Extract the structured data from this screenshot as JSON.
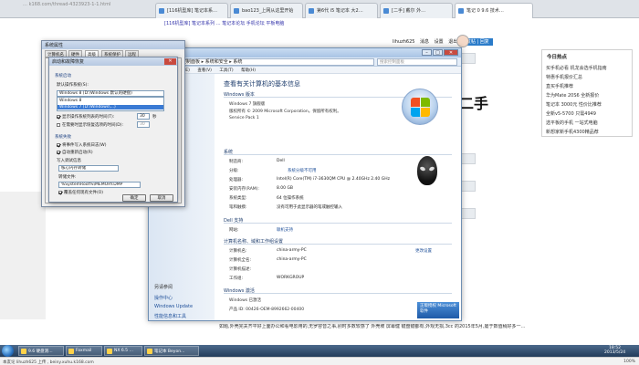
{
  "browser": {
    "url": "… k168.com/thread-4323923-1-1.html",
    "tabs": [
      {
        "label": "[116机型库] 笔记本系…"
      },
      {
        "label": "bao123_上网从这里开始"
      },
      {
        "label": "第6代 i5 笔记本 大2…"
      },
      {
        "label": "[二手] 戴尔 外…"
      },
      {
        "label": "笔记 0 9.6 技术…"
      }
    ]
  },
  "forum": {
    "top_links": "[116机型库]  笔记本系列  …  笔记本论坛  手机论坛  平板电脑",
    "user": "lihuzh625",
    "top_right_items": [
      "消息",
      "设置",
      "退出"
    ],
    "top_button": "发帖 | 回复",
    "big_char": "二手",
    "sidebar_title": "今日热点",
    "sidebar_items": [
      "买手机必看 机龙会选手机指南",
      "特惠手机报价汇总",
      "直买手机推荐",
      "华为Mate 20S6 全新报价",
      "笔记本 3000元 性价比推荐",
      "全新v5-5700 只需4949",
      "选平板的手机 一站式电脑",
      "新想家新手机4300精品荐"
    ],
    "post_text": "如题,外壳完关齐平好上面办公和看电影用的,无罗容音之事,别时多数较感了 外壳坡 屏幕健 键盘键都有,外观无损,3cc 的2015年5月,屡于数值稍好多一…"
  },
  "system_window": {
    "address": "控制面板 ▸ 系统和安全 ▸ 系统",
    "search_placeholder": "搜索控制面板",
    "menu": [
      "文件(F)",
      "编辑(E)",
      "查看(V)",
      "工具(T)",
      "帮助(H)"
    ],
    "left_see_also_title": "另请参阅",
    "left_see_also": [
      "操作中心",
      "Windows Update",
      "性能信息和工具"
    ],
    "title": "查看有关计算机的基本信息",
    "edition": {
      "heading": "Windows 版本",
      "name": "Windows 7 旗舰版",
      "copyright": "版权所有 © 2009 Microsoft Corporation。保留所有权利。",
      "service_pack": "Service Pack 1"
    },
    "system": {
      "heading": "系统",
      "rows": [
        {
          "label": "制造商:",
          "value": "Dell"
        },
        {
          "label": "分级:",
          "value": "系统分级不可用"
        },
        {
          "label": "处理器:",
          "value": "Intel(R) Core(TM) i7-3630QM CPU @ 2.40GHz   2.40 GHz"
        },
        {
          "label": "安装内存(RAM):",
          "value": "8.00 GB"
        },
        {
          "label": "系统类型:",
          "value": "64 位操作系统"
        },
        {
          "label": "笔和触摸:",
          "value": "没有可用于此显示器的笔或触控输入"
        }
      ]
    },
    "dell_support": {
      "heading": "Dell 支持",
      "label": "网站:",
      "value": "联机支持"
    },
    "computer_name": {
      "heading": "计算机名称、域和工作组设置",
      "change_link": "更改设置",
      "rows": [
        {
          "label": "计算机名:",
          "value": "china-army-PC"
        },
        {
          "label": "计算机全名:",
          "value": "china-army-PC"
        },
        {
          "label": "计算机描述:",
          "value": ""
        },
        {
          "label": "工作组:",
          "value": "WORKGROUP"
        }
      ]
    },
    "activation": {
      "heading": "Windows 激活",
      "status": "Windows 已激活",
      "product_id": "产品 ID: 00426-OEM-8992662-00400",
      "badge": "正版授权 Microsoft 软件"
    }
  },
  "props_dialog": {
    "title": "系统属性",
    "tabs": [
      "计算机名",
      "硬件",
      "高级",
      "系统保护",
      "远程"
    ]
  },
  "startup_dialog": {
    "title": "启动和故障恢复",
    "group_startup": "系统启动",
    "default_os_label": "默认操作系统(S):",
    "default_os_value": "Windows 8 (D:\\Windows 默认的硬盘)",
    "dropdown_options": [
      "Windows 8",
      "Windows 7 (D:\\Windows\\...)"
    ],
    "show_list_label": "显示操作系统列表的时间(T):",
    "show_list_value": "30",
    "show_list_unit": "秒",
    "show_recovery_label": "在需要时显示恢复选项的时间(D):",
    "show_recovery_value": "30",
    "group_failure": "系统失败",
    "write_event": "将事件写入系统日志(W)",
    "auto_restart": "自动重新启动(R)",
    "debug_info_label": "写入调试信息",
    "debug_type": "核心内存转储",
    "dump_file_label": "转储文件:",
    "dump_file_value": "%SystemRoot%\\MEMORY.DMP",
    "overwrite": "覆盖任何现有文件(O)",
    "ok": "确定",
    "cancel": "取消"
  },
  "taskbar": {
    "items": [
      "9.6 硬盘测…",
      "Foxmail",
      "NX 6.5 …",
      "笔记本 Beyon…"
    ],
    "time": "18:52",
    "date": "2013/5/24"
  },
  "statusbar": {
    "left": "本友论 lihuzh625 上传 , beiny.xuhu.k168.com",
    "right": "100%"
  }
}
